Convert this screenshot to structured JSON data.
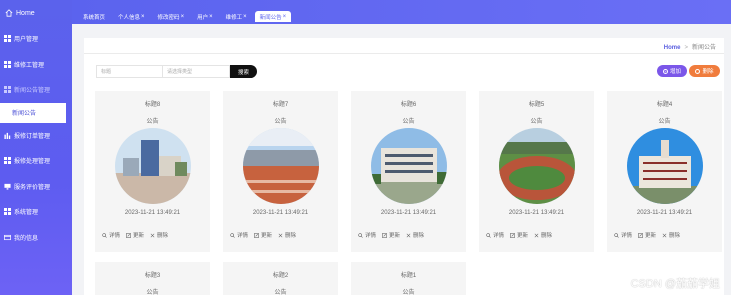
{
  "sidebar": {
    "brand": "Home",
    "items": [
      {
        "label": "用户管理",
        "icon": "grid-icon"
      },
      {
        "label": "维修工管理",
        "icon": "grid-icon"
      },
      {
        "label": "新闻公告管理",
        "icon": "grid-icon",
        "expanded": true
      },
      {
        "label": "报修订单管理",
        "icon": "bar-chart-icon"
      },
      {
        "label": "报修处理管理",
        "icon": "grid-icon"
      },
      {
        "label": "服务评价管理",
        "icon": "monitor-icon"
      },
      {
        "label": "系统管理",
        "icon": "grid-icon"
      },
      {
        "label": "我的信息",
        "icon": "card-icon"
      }
    ],
    "submenu_label": "新闻公告"
  },
  "tabs": [
    {
      "label": "系统首页",
      "closable": false
    },
    {
      "label": "个人信息",
      "closable": true
    },
    {
      "label": "修改密码",
      "closable": true
    },
    {
      "label": "用户",
      "closable": true
    },
    {
      "label": "维修工",
      "closable": true
    },
    {
      "label": "新闻公告",
      "closable": true,
      "active": true
    }
  ],
  "breadcrumb": {
    "home": "Home",
    "sep": ">",
    "current": "新闻公告"
  },
  "search": {
    "title_placeholder": "标题",
    "type_placeholder": "请选择类型",
    "button": "搜索"
  },
  "actions": {
    "add": "增加",
    "delete": "删除"
  },
  "cards": [
    {
      "title": "标题8",
      "kind": "公告",
      "time": "2023-11-21 13:49:21"
    },
    {
      "title": "标题7",
      "kind": "公告",
      "time": "2023-11-21 13:49:21"
    },
    {
      "title": "标题6",
      "kind": "公告",
      "time": "2023-11-21 13:49:21"
    },
    {
      "title": "标题5",
      "kind": "公告",
      "time": "2023-11-21 13:49:21"
    },
    {
      "title": "标题4",
      "kind": "公告",
      "time": "2023-11-21 13:49:21"
    },
    {
      "title": "标题3",
      "kind": "公告"
    },
    {
      "title": "标题2",
      "kind": "公告"
    },
    {
      "title": "标题1",
      "kind": "公告"
    }
  ],
  "card_actions": {
    "detail": "详情",
    "edit": "更新",
    "remove": "删除"
  },
  "watermark": "CSDN @茄茄学姐",
  "colors": {
    "sidebar": "#5b62ec",
    "add_button": "#7b57e9",
    "delete_button": "#f07c3d",
    "search_button": "#111111"
  }
}
